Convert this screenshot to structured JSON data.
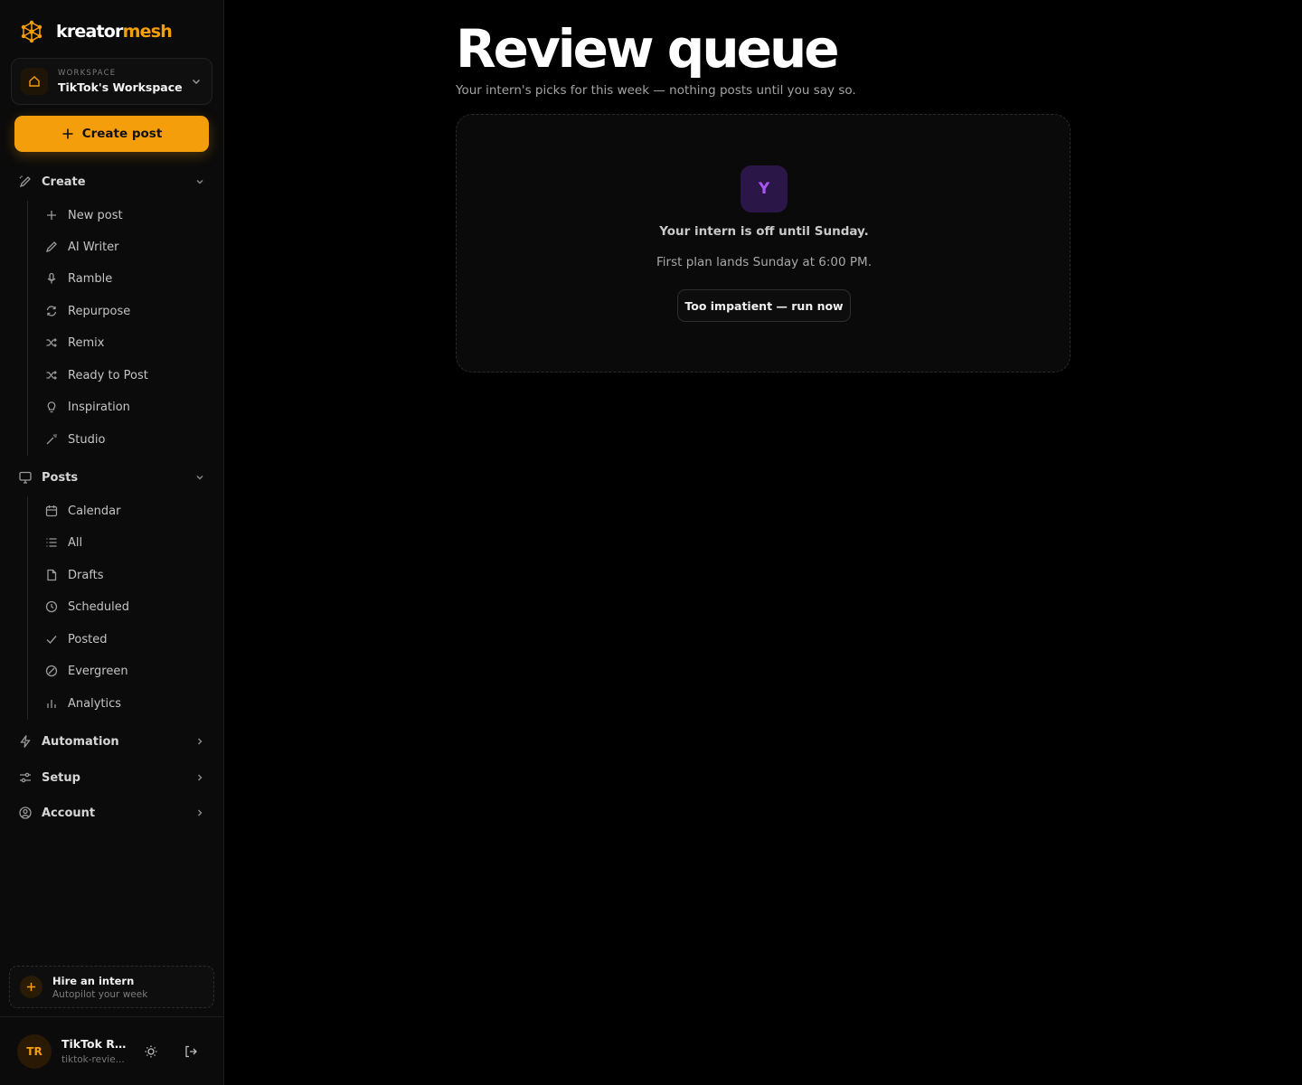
{
  "brand": {
    "part1": "kreator",
    "part2": "mesh",
    "accent": "#f59e0b"
  },
  "workspace": {
    "caption": "WORKSPACE",
    "name": "TikTok's Workspace"
  },
  "create_button": {
    "label": "Create post",
    "icon": "plus-icon"
  },
  "nav": {
    "create": {
      "label": "Create",
      "items": [
        {
          "label": "New post",
          "icon": "plus-icon"
        },
        {
          "label": "AI Writer",
          "icon": "pencil-icon"
        },
        {
          "label": "Ramble",
          "icon": "microphone-icon"
        },
        {
          "label": "Repurpose",
          "icon": "refresh-icon"
        },
        {
          "label": "Remix",
          "icon": "shuffle-icon"
        },
        {
          "label": "Ready to Post",
          "icon": "shuffle-icon"
        },
        {
          "label": "Inspiration",
          "icon": "lightbulb-icon"
        },
        {
          "label": "Studio",
          "icon": "magic-wand-icon"
        }
      ]
    },
    "posts": {
      "label": "Posts",
      "items": [
        {
          "label": "Calendar",
          "icon": "calendar-icon"
        },
        {
          "label": "All",
          "icon": "list-icon"
        },
        {
          "label": "Drafts",
          "icon": "file-icon"
        },
        {
          "label": "Scheduled",
          "icon": "clock-icon"
        },
        {
          "label": "Posted",
          "icon": "check-icon"
        },
        {
          "label": "Evergreen",
          "icon": "leaf-icon"
        },
        {
          "label": "Analytics",
          "icon": "bar-chart-icon"
        }
      ]
    },
    "automation": {
      "label": "Automation",
      "icon": "lightning-icon"
    },
    "setup": {
      "label": "Setup",
      "icon": "sliders-icon"
    },
    "account": {
      "label": "Account",
      "icon": "user-circle-icon"
    }
  },
  "intern_card": {
    "title": "Hire an intern",
    "subtitle": "Autopilot your week"
  },
  "user": {
    "initials": "TR",
    "name": "TikTok Re...",
    "handle": "tiktok-revie..."
  },
  "main": {
    "title": "Review queue",
    "subtitle": "Your intern's picks for this week — nothing posts until you say so.",
    "empty": {
      "avatar_letter": "Y",
      "title": "Your intern is off until Sunday.",
      "subtitle": "First plan lands Sunday at 6:00 PM.",
      "button": "Too impatient — run now"
    }
  }
}
